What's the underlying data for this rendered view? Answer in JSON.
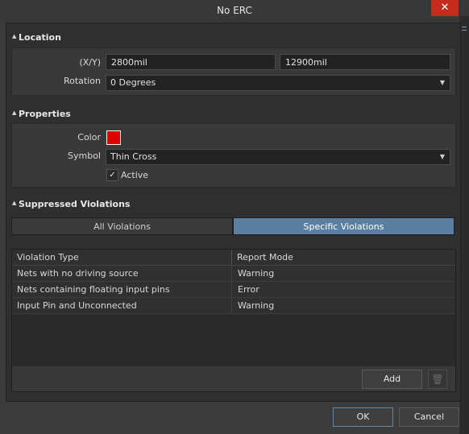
{
  "window": {
    "title": "No ERC",
    "close_glyph": "✕"
  },
  "location": {
    "header": "Location",
    "xy_label": "(X/Y)",
    "x_value": "2800mil",
    "y_value": "12900mil",
    "rotation_label": "Rotation",
    "rotation_value": "0 Degrees"
  },
  "properties": {
    "header": "Properties",
    "color_label": "Color",
    "color_value": "#e00000",
    "symbol_label": "Symbol",
    "symbol_value": "Thin Cross",
    "active_label": "Active",
    "active_checked": true
  },
  "suppressed": {
    "header": "Suppressed Violations",
    "tabs": [
      {
        "label": "All Violations",
        "selected": false
      },
      {
        "label": "Specific Violations",
        "selected": true
      }
    ],
    "columns": [
      "Violation Type",
      "Report Mode"
    ],
    "rows": [
      {
        "type": "Nets with no driving source",
        "mode": "Warning"
      },
      {
        "type": "Nets containing floating input pins",
        "mode": "Error"
      },
      {
        "type": "Input Pin and Unconnected",
        "mode": "Warning"
      }
    ],
    "add_label": "Add"
  },
  "footer": {
    "ok_label": "OK",
    "cancel_label": "Cancel"
  },
  "colors": {
    "accent": "#5b7fa0",
    "close": "#c42b1c"
  }
}
